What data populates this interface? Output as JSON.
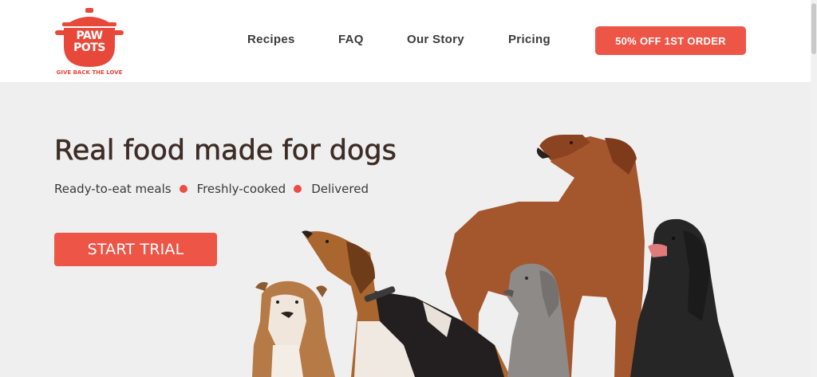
{
  "header": {
    "logo": {
      "line1": "PAW",
      "line2": "POTS",
      "tagline": "GIVE BACK THE LOVE"
    },
    "nav": [
      {
        "label": "Recipes"
      },
      {
        "label": "FAQ"
      },
      {
        "label": "Our Story"
      },
      {
        "label": "Pricing"
      }
    ],
    "cta_label": "50% OFF 1ST ORDER"
  },
  "hero": {
    "title": "Real food made for dogs",
    "features": [
      "Ready-to-eat meals",
      "Freshly-cooked",
      "Delivered"
    ],
    "button_label": "START TRIAL",
    "image": "group of five dogs"
  },
  "colors": {
    "accent": "#ed5547",
    "heading": "#3d2d26",
    "hero_bg": "#efefef"
  }
}
